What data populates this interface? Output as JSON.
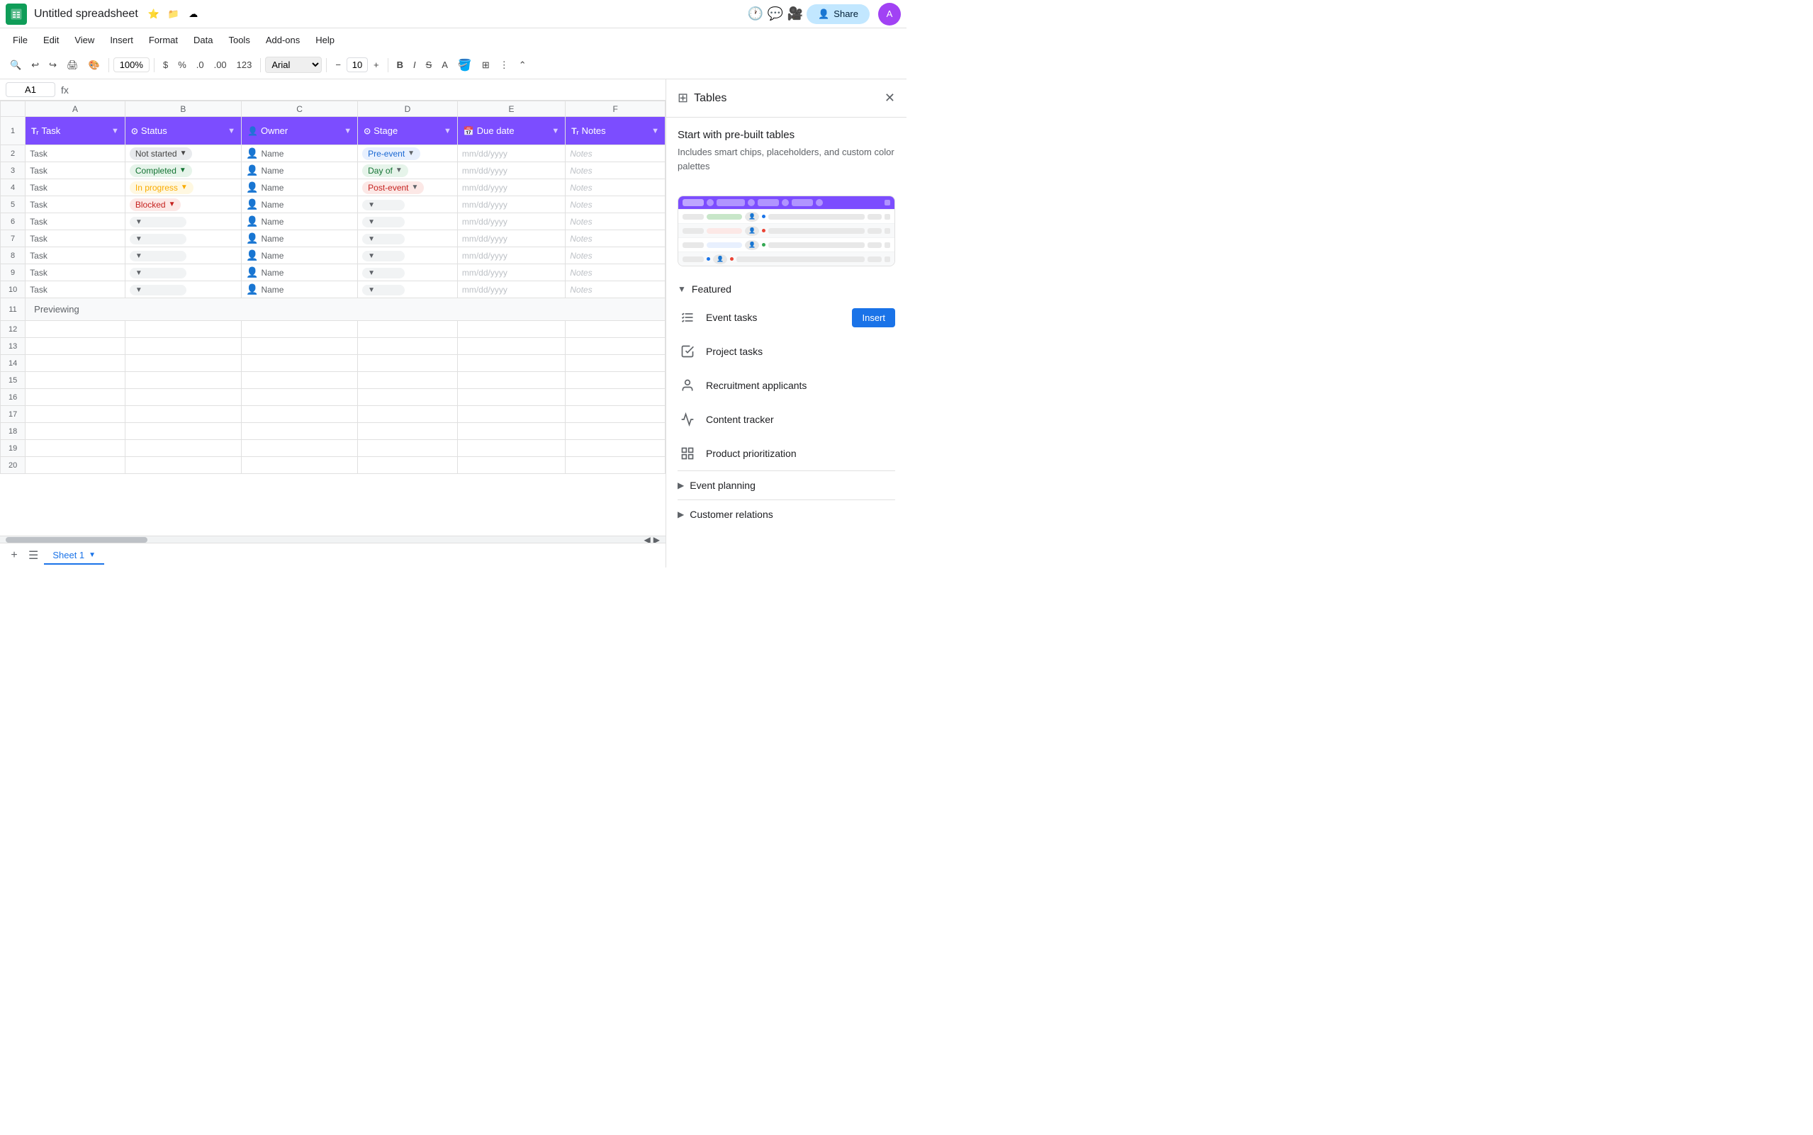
{
  "app": {
    "title": "Untitled spreadsheet",
    "icon_color": "#0f9d58"
  },
  "menu": {
    "items": [
      "File",
      "Edit",
      "View",
      "Insert",
      "Format",
      "Data",
      "Tools",
      "Add-ons",
      "Help"
    ]
  },
  "toolbar": {
    "zoom": "100%",
    "font": "Arial",
    "font_size": "10",
    "currency_symbol": "$",
    "percent_symbol": "%",
    "decimal_decrease": ".0",
    "decimal_increase": ".00",
    "number_format": "123"
  },
  "formula_bar": {
    "cell_ref": "A1",
    "fx_label": "fx"
  },
  "sheet": {
    "columns": [
      {
        "id": "A",
        "label": "Task",
        "type": "Tr",
        "width": 120
      },
      {
        "id": "B",
        "label": "Status",
        "type": "⊙",
        "width": 140
      },
      {
        "id": "C",
        "label": "Owner",
        "type": "👤",
        "width": 140
      },
      {
        "id": "D",
        "label": "Stage",
        "type": "⊙",
        "width": 120
      },
      {
        "id": "E",
        "label": "Due date",
        "type": "📅",
        "width": 120
      },
      {
        "id": "F",
        "label": "Notes",
        "type": "Tr",
        "width": 120
      }
    ],
    "rows": [
      {
        "row": 1,
        "is_header": true
      },
      {
        "row": 2,
        "task": "Task",
        "status": "Not started",
        "status_type": "notstarted",
        "owner": "Name",
        "stage": "Pre-event",
        "stage_type": "preevent",
        "due_date": "mm/dd/yyyy",
        "notes": "Notes"
      },
      {
        "row": 3,
        "task": "Task",
        "status": "Completed",
        "status_type": "completed",
        "owner": "Name",
        "stage": "Day of",
        "stage_type": "dayof",
        "due_date": "mm/dd/yyyy",
        "notes": "Notes"
      },
      {
        "row": 4,
        "task": "Task",
        "status": "In progress",
        "status_type": "inprogress",
        "owner": "Name",
        "stage": "Post-event",
        "stage_type": "postevent",
        "due_date": "mm/dd/yyyy",
        "notes": "Notes"
      },
      {
        "row": 5,
        "task": "Task",
        "status": "Blocked",
        "status_type": "blocked",
        "owner": "Name",
        "stage": "",
        "stage_type": "empty",
        "due_date": "mm/dd/yyyy",
        "notes": "Notes"
      },
      {
        "row": 6,
        "task": "Task",
        "status": "",
        "status_type": "empty",
        "owner": "Name",
        "stage": "",
        "stage_type": "empty",
        "due_date": "mm/dd/yyyy",
        "notes": "Notes"
      },
      {
        "row": 7,
        "task": "Task",
        "status": "",
        "status_type": "empty",
        "owner": "Name",
        "stage": "",
        "stage_type": "empty",
        "due_date": "mm/dd/yyyy",
        "notes": "Notes"
      },
      {
        "row": 8,
        "task": "Task",
        "status": "",
        "status_type": "empty",
        "owner": "Name",
        "stage": "",
        "stage_type": "empty",
        "due_date": "mm/dd/yyyy",
        "notes": "Notes"
      },
      {
        "row": 9,
        "task": "Task",
        "status": "",
        "status_type": "empty",
        "owner": "Name",
        "stage": "",
        "stage_type": "empty",
        "due_date": "mm/dd/yyyy",
        "notes": "Notes"
      },
      {
        "row": 10,
        "task": "Task",
        "status": "",
        "status_type": "empty",
        "owner": "Name",
        "stage": "",
        "stage_type": "empty",
        "due_date": "mm/dd/yyyy",
        "notes": "Notes"
      }
    ],
    "previewing_label": "Previewing",
    "row_numbers": [
      11,
      12,
      13,
      14,
      15,
      16,
      17,
      18,
      19,
      20
    ]
  },
  "bottom_bar": {
    "sheet_tab": "Sheet 1",
    "add_sheet_label": "+"
  },
  "right_panel": {
    "title": "Tables",
    "intro_title": "Start with pre-built tables",
    "intro_desc": "Includes smart chips, placeholders, and custom color palettes",
    "featured_label": "Featured",
    "featured_expanded": true,
    "templates": [
      {
        "id": "event-tasks",
        "label": "Event tasks",
        "icon": "checklist",
        "show_insert": true
      },
      {
        "id": "project-tasks",
        "label": "Project tasks",
        "icon": "checklist-done",
        "show_insert": false
      },
      {
        "id": "recruitment",
        "label": "Recruitment applicants",
        "icon": "person",
        "show_insert": false
      },
      {
        "id": "content-tracker",
        "label": "Content tracker",
        "icon": "trending-up",
        "show_insert": false
      },
      {
        "id": "product-prioritization",
        "label": "Product prioritization",
        "icon": "table",
        "show_insert": false
      }
    ],
    "insert_label": "Insert",
    "sections": [
      {
        "id": "event-planning",
        "label": "Event planning",
        "expanded": false
      },
      {
        "id": "customer-relations",
        "label": "Customer relations",
        "expanded": false
      }
    ]
  }
}
